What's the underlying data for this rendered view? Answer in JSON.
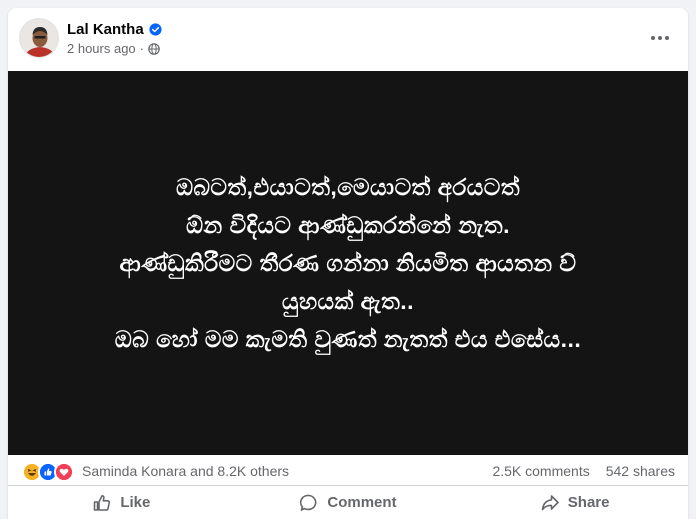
{
  "post": {
    "author": "Lal Kantha",
    "timestamp": "2 hours ago",
    "separator": "·",
    "privacy_icon": "globe-icon",
    "verified_icon": "verified-badge-icon",
    "more_icon": "more-options-icon"
  },
  "image_text": {
    "line1": "ඔබටත්,එයාටත්,මෙයාටත් අරයටත්",
    "line2": "ඕන විදියට ආණ්ඩුකරන්නේ නැත.",
    "line3": "ආණ්ඩුකිරීමට තීරණ ගන්නා නියමිත ආයතන ව්",
    "line4": "යුහයක් ඇත..",
    "line5": "ඔබ හෝ මම කැමති වුණත් නැතත් එය එසේය..."
  },
  "stats": {
    "reactions_label": "Saminda Konara and 8.2K others",
    "comments": "2.5K comments",
    "shares": "542 shares",
    "reaction_icons": [
      "haha-icon",
      "like-icon",
      "love-icon"
    ]
  },
  "actions": {
    "like": "Like",
    "comment": "Comment",
    "share": "Share"
  },
  "colors": {
    "background": "#f0f2f5",
    "card": "#ffffff",
    "image_bg": "#141414",
    "secondary_text": "#65676b",
    "verified": "#0866ff",
    "like_blue": "#0866ff",
    "love_red": "#f33e58",
    "haha_yellow": "#f7b125"
  }
}
